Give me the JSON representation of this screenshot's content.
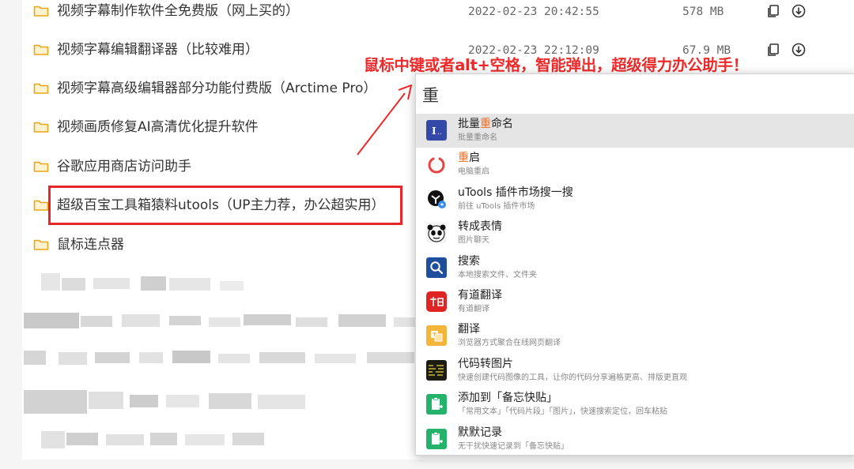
{
  "files": [
    {
      "name": "视频字幕制作软件全免费版（网上买的）",
      "date": "2022-02-23 20:42:55",
      "size": "578 MB",
      "actions": true
    },
    {
      "name": "视频字幕编辑翻译器（比较难用）",
      "date": "2022-02-23 22:12:09",
      "size": "67.9 MB",
      "actions": true
    },
    {
      "name": "视频字幕高级编辑器部分功能付费版（Arctime Pro）",
      "date": "",
      "size": "",
      "actions": false
    },
    {
      "name": "视频画质修复AI高清优化提升软件",
      "date": "",
      "size": "",
      "actions": false
    },
    {
      "name": "谷歌应用商店访问助手",
      "date": "",
      "size": "",
      "actions": false
    },
    {
      "name": "超级百宝工具箱猿料utools（UP主力荐，办公超实用）",
      "date": "",
      "size": "",
      "actions": false
    },
    {
      "name": "鼠标连点器",
      "date": "",
      "size": "",
      "actions": false
    }
  ],
  "annotation": {
    "text": "鼠标中键或者alt+空格，智能弹出，超级得力办公助手！",
    "color": "#ee2a2a"
  },
  "popup": {
    "query": "重",
    "highlight_color": "#f06d23",
    "results": [
      {
        "title_before": "批量",
        "title_hl": "重",
        "title_after": "命名",
        "desc": "批量重命名",
        "icon": "batch-rename-icon",
        "selected": true
      },
      {
        "title_before": "",
        "title_hl": "重",
        "title_after": "启",
        "desc": "电脑重启",
        "icon": "restart-icon",
        "selected": false
      },
      {
        "title_before": "uTools 插件市场搜一搜",
        "title_hl": "",
        "title_after": "",
        "desc": "前往 uTools 插件市场",
        "icon": "plugin-market-icon",
        "selected": false
      },
      {
        "title_before": "转成表情",
        "title_hl": "",
        "title_after": "",
        "desc": "图片聊天",
        "icon": "emoji-panda-icon",
        "selected": false
      },
      {
        "title_before": "搜索",
        "title_hl": "",
        "title_after": "",
        "desc": "本地搜索文件、文件夹",
        "icon": "search-icon",
        "selected": false
      },
      {
        "title_before": "有道翻译",
        "title_hl": "",
        "title_after": "",
        "desc": "有道翻译",
        "icon": "youdao-icon",
        "selected": false
      },
      {
        "title_before": "翻译",
        "title_hl": "",
        "title_after": "",
        "desc": "浏览器方式聚合在线网页翻译",
        "icon": "translate-icon",
        "selected": false
      },
      {
        "title_before": "代码转图片",
        "title_hl": "",
        "title_after": "",
        "desc": "快速创建代码图像的工具，让你的代码分享遍格更高、排版更直观",
        "icon": "code-image-icon",
        "selected": false
      },
      {
        "title_before": "添加到「备忘快贴」",
        "title_hl": "",
        "title_after": "",
        "desc": "「常用文本」「代码片段」「图片」，快速搜索定位，回车粘贴",
        "icon": "memo-paste-icon",
        "selected": false
      },
      {
        "title_before": "默默记录",
        "title_hl": "",
        "title_after": "",
        "desc": "无干扰快速记录到「备忘快贴」",
        "icon": "quick-record-icon",
        "selected": false
      }
    ]
  },
  "colors": {
    "folder": "#f6b92b",
    "highlight_box": "#e8262a",
    "selected_row": "#e5e5e5"
  }
}
